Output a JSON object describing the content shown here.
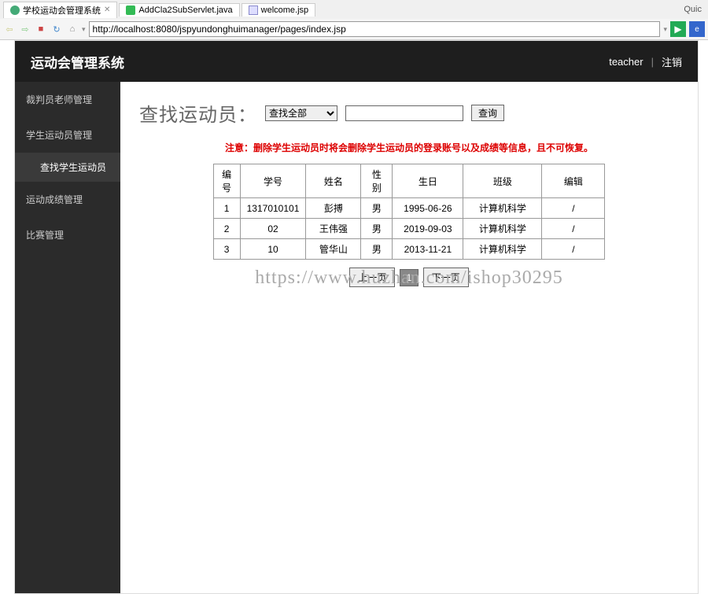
{
  "browser": {
    "tabs": [
      {
        "icon": "ball",
        "label": "学校运动会管理系统"
      },
      {
        "icon": "java",
        "label": "AddCla2SubServlet.java"
      },
      {
        "icon": "jsp",
        "label": "welcome.jsp"
      }
    ],
    "right_label": "Quic",
    "url": "http://localhost:8080/jspyundonghuimanager/pages/index.jsp"
  },
  "header": {
    "title": "运动会管理系统",
    "user": "teacher",
    "logout": "注销"
  },
  "sidebar": {
    "items": [
      {
        "label": "裁判员老师管理",
        "active": false
      },
      {
        "label": "学生运动员管理",
        "active": false
      },
      {
        "label": "查找学生运动员",
        "sub": true,
        "active": true
      },
      {
        "label": "运动成绩管理",
        "active": false
      },
      {
        "label": "比赛管理",
        "active": false
      }
    ]
  },
  "search": {
    "title": "查找运动员：",
    "select_value": "查找全部",
    "input_value": "",
    "button": "查询"
  },
  "notice": "注意：删除学生运动员时将会删除学生运动员的登录账号以及成绩等信息，且不可恢复。",
  "table": {
    "headers": [
      "编号",
      "学号",
      "姓名",
      "性别",
      "生日",
      "班级",
      "编辑"
    ],
    "rows": [
      [
        "1",
        "1317010101",
        "彭搏",
        "男",
        "1995-06-26",
        "计算机科学",
        "/"
      ],
      [
        "2",
        "02",
        "王伟强",
        "男",
        "2019-09-03",
        "计算机科学",
        "/"
      ],
      [
        "3",
        "10",
        "管华山",
        "男",
        "2013-11-21",
        "计算机科学",
        "/"
      ]
    ]
  },
  "pager": {
    "prev": "上一页",
    "current": "1",
    "next": "下一页"
  },
  "watermark": "https://www.huzhan.com/ishop30295"
}
